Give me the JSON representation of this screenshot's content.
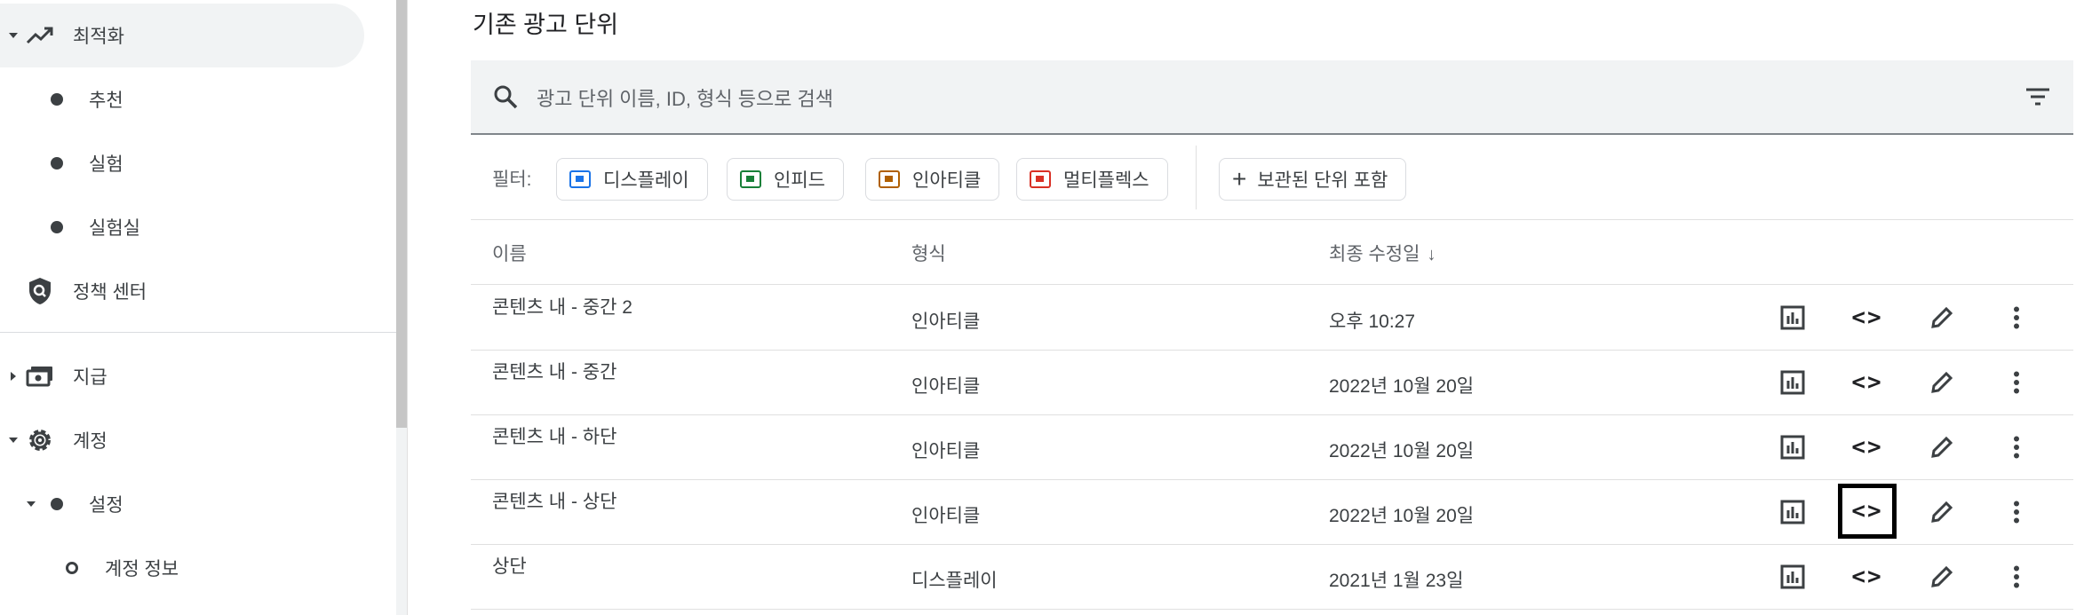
{
  "sidebar": {
    "optimization": {
      "label": "최적화"
    },
    "sub_items": [
      {
        "label": "추천"
      },
      {
        "label": "실험"
      },
      {
        "label": "실험실"
      }
    ],
    "policy_center": {
      "label": "정책 센터"
    },
    "payments": {
      "label": "지급"
    },
    "account": {
      "label": "계정"
    },
    "settings": {
      "label": "설정"
    },
    "account_info": {
      "label": "계정 정보"
    }
  },
  "main": {
    "section_title": "기존 광고 단위",
    "search": {
      "placeholder": "광고 단위 이름, ID, 형식 등으로 검색"
    },
    "filters": {
      "label": "필터:",
      "chips": [
        {
          "label": "디스플레이",
          "color": "#1a73e8"
        },
        {
          "label": "인피드",
          "color": "#188038"
        },
        {
          "label": "인아티클",
          "color": "#b06000"
        },
        {
          "label": "멀티플렉스",
          "color": "#d93025"
        }
      ],
      "include_archived": "보관된 단위 포함"
    },
    "table": {
      "headers": {
        "name": "이름",
        "type": "형식",
        "modified": "최종 수정일"
      },
      "rows": [
        {
          "name": "콘텐츠 내 - 중간 2",
          "type": "인아티클",
          "modified": "오후 10:27"
        },
        {
          "name": "콘텐츠 내 - 중간",
          "type": "인아티클",
          "modified": "2022년 10월 20일"
        },
        {
          "name": "콘텐츠 내 - 하단",
          "type": "인아티클",
          "modified": "2022년 10월 20일"
        },
        {
          "name": "콘텐츠 내 - 상단",
          "type": "인아티클",
          "modified": "2022년 10월 20일"
        },
        {
          "name": "상단",
          "type": "디스플레이",
          "modified": "2021년 1월 23일"
        }
      ]
    }
  }
}
